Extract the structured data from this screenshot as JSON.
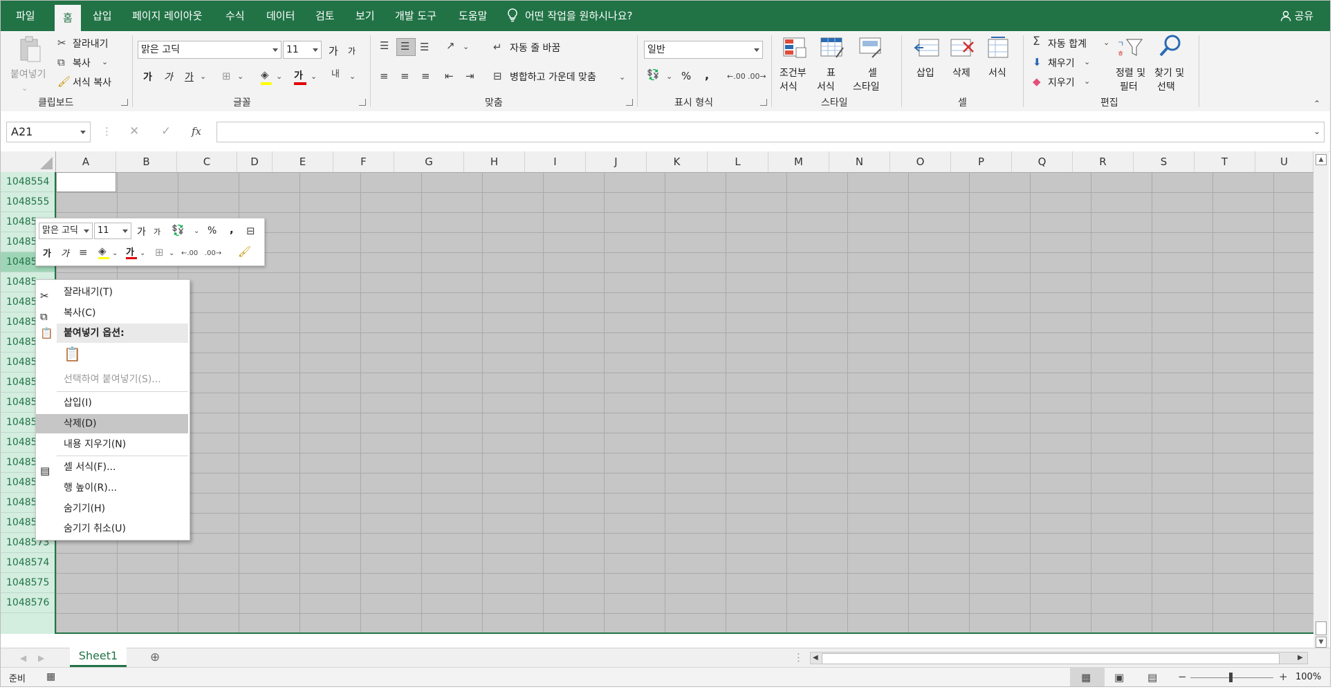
{
  "tabs": {
    "file": "파일",
    "home": "홈",
    "insert": "삽입",
    "layout": "페이지 레이아웃",
    "formulas": "수식",
    "data": "데이터",
    "review": "검토",
    "view": "보기",
    "developer": "개발 도구",
    "help": "도움말",
    "tellme": "어떤 작업을 원하시나요?",
    "share": "공유"
  },
  "ribbon": {
    "clipboard": {
      "label": "클립보드",
      "paste": "붙여넣기",
      "cut": "잘라내기",
      "copy": "복사",
      "format_painter": "서식 복사"
    },
    "font": {
      "label": "글꼴",
      "name": "맑은 고딕",
      "size": "11",
      "bold": "가",
      "italic": "가",
      "underline": "가",
      "grow": "가",
      "shrink": "가",
      "color": "가"
    },
    "alignment": {
      "label": "맞춤",
      "wrap": "자동 줄 바꿈",
      "merge": "병합하고 가운데 맞춤"
    },
    "number": {
      "label": "표시 형식",
      "format": "일반",
      "percent": "%",
      "comma": ","
    },
    "styles": {
      "label": "스타일",
      "conditional1": "조건부",
      "conditional2": "서식",
      "table1": "표",
      "table2": "서식",
      "cell1": "셀",
      "cell2": "스타일"
    },
    "cells": {
      "label": "셀",
      "insert": "삽입",
      "delete": "삭제",
      "format": "서식"
    },
    "editing": {
      "label": "편집",
      "autosum": "자동 합계",
      "fill": "채우기",
      "clear": "지우기",
      "sort1": "정렬 및",
      "sort2": "필터",
      "find1": "찾기 및",
      "find2": "선택"
    }
  },
  "formula_bar": {
    "name_box": "A21",
    "cancel": "✕",
    "enter": "✓",
    "fx": "fx",
    "value": ""
  },
  "columns": [
    "A",
    "B",
    "C",
    "D",
    "E",
    "F",
    "G",
    "H",
    "I",
    "J",
    "K",
    "L",
    "M",
    "N",
    "O",
    "P",
    "Q",
    "R",
    "S",
    "T",
    "U"
  ],
  "rows": [
    "1048554",
    "1048555",
    "10485",
    "10485",
    "10485",
    "10485",
    "10485",
    "10485",
    "10485",
    "10485",
    "10485",
    "10485",
    "10485",
    "10485",
    "10485",
    "10485",
    "10485",
    "1048572",
    "1048573",
    "1048574",
    "1048575",
    "1048576"
  ],
  "mini_toolbar": {
    "font": "맑은 고딕",
    "size": "11",
    "percent": "%",
    "comma": ",",
    "bold": "가",
    "italic": "가",
    "color": "가",
    "grow": "가",
    "shrink": "가"
  },
  "context_menu": {
    "cut": "잘라내기(T)",
    "copy": "복사(C)",
    "paste_options": "붙여넣기 옵션:",
    "paste_special": "선택하여 붙여넣기(S)...",
    "insert": "삽입(I)",
    "delete": "삭제(D)",
    "clear": "내용 지우기(N)",
    "format_cells": "셀 서식(F)...",
    "row_height": "행 높이(R)...",
    "hide": "숨기기(H)",
    "unhide": "숨기기 취소(U)"
  },
  "sheets": [
    "Sheet1"
  ],
  "status": {
    "ready": "준비",
    "zoom": "100%",
    "minus": "−",
    "plus": "+"
  },
  "colors": {
    "accent": "#217346",
    "selected_fill": "#c6c6c6",
    "row_header_selected": "#d3eddf"
  }
}
